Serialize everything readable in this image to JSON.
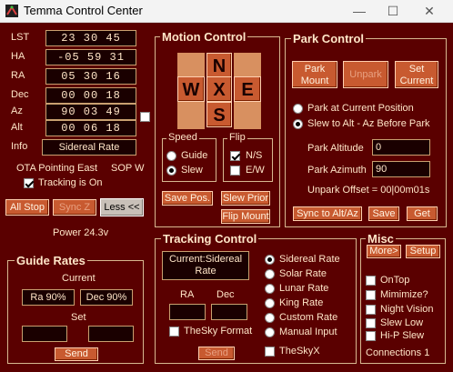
{
  "window": {
    "title": "Temma Control Center"
  },
  "coords": [
    {
      "label": "LST",
      "value": "23 30 45"
    },
    {
      "label": "HA",
      "value": "-05 59 31"
    },
    {
      "label": "RA",
      "value": "05 30 16"
    },
    {
      "label": "Dec",
      "value": "00 00 18"
    },
    {
      "label": "Az",
      "value": "90 03 49"
    },
    {
      "label": "Alt",
      "value": "00 06 18"
    },
    {
      "label": "Info",
      "value": "Sidereal Rate"
    }
  ],
  "status": {
    "ota": "OTA Pointing East",
    "sop": "SOP W",
    "tracking": "Tracking is On",
    "power": "Power 24.3v"
  },
  "left_buttons": {
    "all_stop": "All Stop",
    "sync": "Sync Z",
    "less": "Less <<"
  },
  "motion": {
    "title": "Motion Control",
    "n": "N",
    "s": "S",
    "e": "E",
    "w": "W",
    "x": "X",
    "speed_title": "Speed",
    "guide": "Guide",
    "slew": "Slew",
    "flip_title": "Flip",
    "ns": "N/S",
    "ew": "E/W",
    "save_pos": "Save Pos.",
    "slew_prior": "Slew Prior",
    "flip_mount": "Flip Mount"
  },
  "park": {
    "title": "Park Control",
    "park_mount": "Park\nMount",
    "unpark": "Unpark",
    "set_current": "Set\nCurrent",
    "opt1": "Park at Current Position",
    "opt2": "Slew to Alt - Az Before Park",
    "alt_label": "Park Altitude",
    "alt_value": "0",
    "az_label": "Park Azimuth",
    "az_value": "90",
    "unpark_offset": "Unpark Offset = 00|00m01s",
    "sync_altaz": "Sync to Alt/Az",
    "save": "Save",
    "get": "Get"
  },
  "guide": {
    "title": "Guide Rates",
    "current": "Current",
    "ra": "Ra 90%",
    "dec": "Dec 90%",
    "set": "Set",
    "send": "Send"
  },
  "tracking": {
    "title": "Tracking Control",
    "current": "Current:Sidereal\nRate",
    "ra": "RA",
    "dec": "Dec",
    "thesky_format": "TheSky Format",
    "send": "Send",
    "rates": [
      "Sidereal Rate",
      "Solar Rate",
      "Lunar Rate",
      "King Rate",
      "Custom Rate",
      "Manual Input"
    ],
    "theskyx": "TheSkyX"
  },
  "misc": {
    "title": "Misc",
    "more": "More>",
    "setup": "Setup",
    "options": [
      "OnTop",
      "Mimimize?",
      "Night Vision",
      "Slew Low",
      "Hi-P Slew"
    ],
    "connections": "Connections 1"
  },
  "colors": {
    "background": "#5a0000",
    "button": "#c85a30",
    "text": "#ffe6c8"
  }
}
